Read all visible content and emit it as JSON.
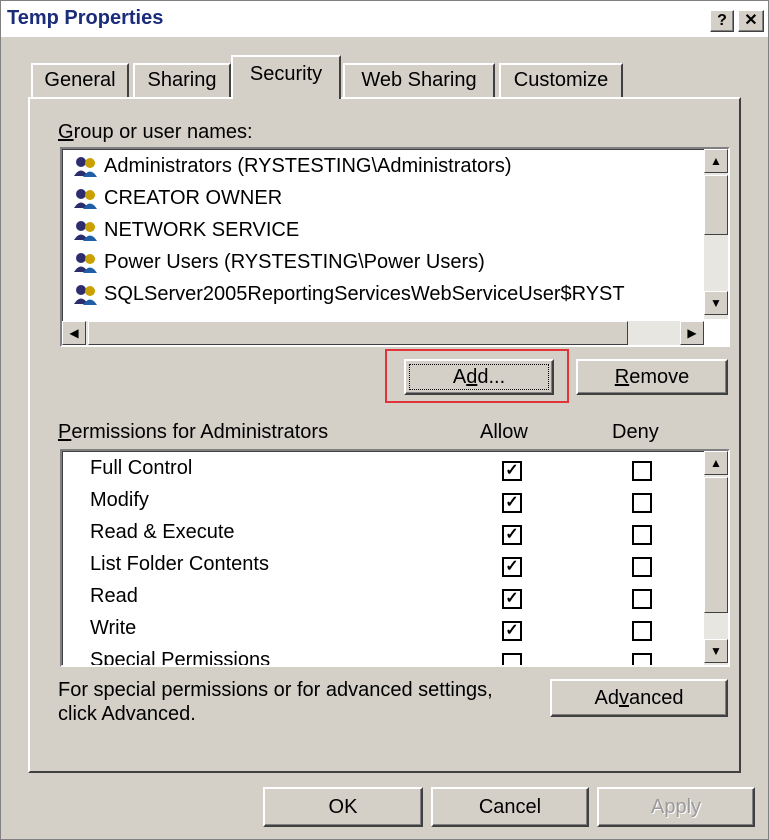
{
  "window": {
    "title": "Temp Properties",
    "help_label": "?",
    "close_label": "✕"
  },
  "tabs": [
    {
      "label": "General"
    },
    {
      "label": "Sharing"
    },
    {
      "label": "Security"
    },
    {
      "label": "Web Sharing"
    },
    {
      "label": "Customize"
    }
  ],
  "groups": {
    "label_u": "G",
    "label_rest": "roup or user names:",
    "items": [
      {
        "name": "Administrators (RYSTESTING\\Administrators)"
      },
      {
        "name": "CREATOR OWNER"
      },
      {
        "name": "NETWORK SERVICE"
      },
      {
        "name": "Power Users (RYSTESTING\\Power Users)"
      },
      {
        "name": "SQLServer2005ReportingServicesWebServiceUser$RYST"
      }
    ]
  },
  "buttons": {
    "add_pre": "A",
    "add_u": "d",
    "add_post": "d...",
    "remove_u": "R",
    "remove_rest": "emove",
    "advanced_pre": "Ad",
    "advanced_u": "v",
    "advanced_post": "anced",
    "ok": "OK",
    "cancel": "Cancel",
    "apply": "Apply"
  },
  "permissions": {
    "label_u": "P",
    "label_rest": "ermissions for Administrators",
    "allow_header": "Allow",
    "deny_header": "Deny",
    "rows": [
      {
        "name": "Full Control",
        "allow": true,
        "deny": false
      },
      {
        "name": "Modify",
        "allow": true,
        "deny": false
      },
      {
        "name": "Read & Execute",
        "allow": true,
        "deny": false
      },
      {
        "name": "List Folder Contents",
        "allow": true,
        "deny": false
      },
      {
        "name": "Read",
        "allow": true,
        "deny": false
      },
      {
        "name": "Write",
        "allow": true,
        "deny": false
      },
      {
        "name": "Special Permissions",
        "allow": false,
        "deny": false
      }
    ]
  },
  "note": {
    "line1": "For special permissions or for advanced settings,",
    "line2": "click Advanced."
  },
  "colors": {
    "title_text": "#1a2c7a",
    "highlight_box": "#e0343a",
    "face": "#d4d0c8"
  }
}
